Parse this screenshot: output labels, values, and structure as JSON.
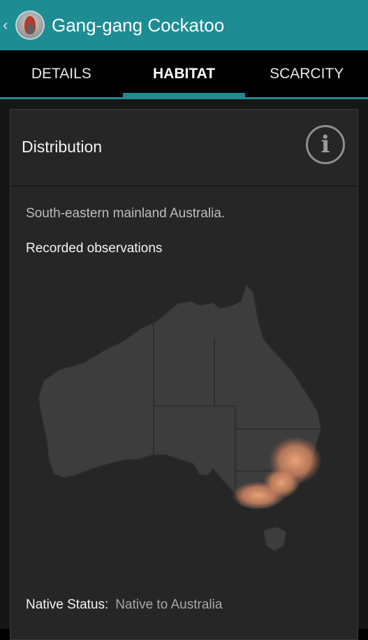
{
  "actionbar": {
    "title": "Gang-gang Cockatoo",
    "up_icon": "chevron-left-icon",
    "app_icon": "gang-gang-cockatoo-avatar"
  },
  "tabs": [
    {
      "label": "DETAILS",
      "active": false
    },
    {
      "label": "HABITAT",
      "active": true
    },
    {
      "label": "SCARCITY",
      "active": false
    }
  ],
  "card": {
    "title": "Distribution",
    "info_icon": "info-icon",
    "info_glyph": "i",
    "description": "South-eastern mainland Australia.",
    "observations_label": "Recorded observations",
    "native_status_key": "Native Status:",
    "native_status_value": "Native to Australia"
  },
  "colors": {
    "accent": "#1e8c93",
    "map_land": "#3d3d3d",
    "map_border": "#2a2a2a",
    "observation_heat": "#f0a070"
  }
}
